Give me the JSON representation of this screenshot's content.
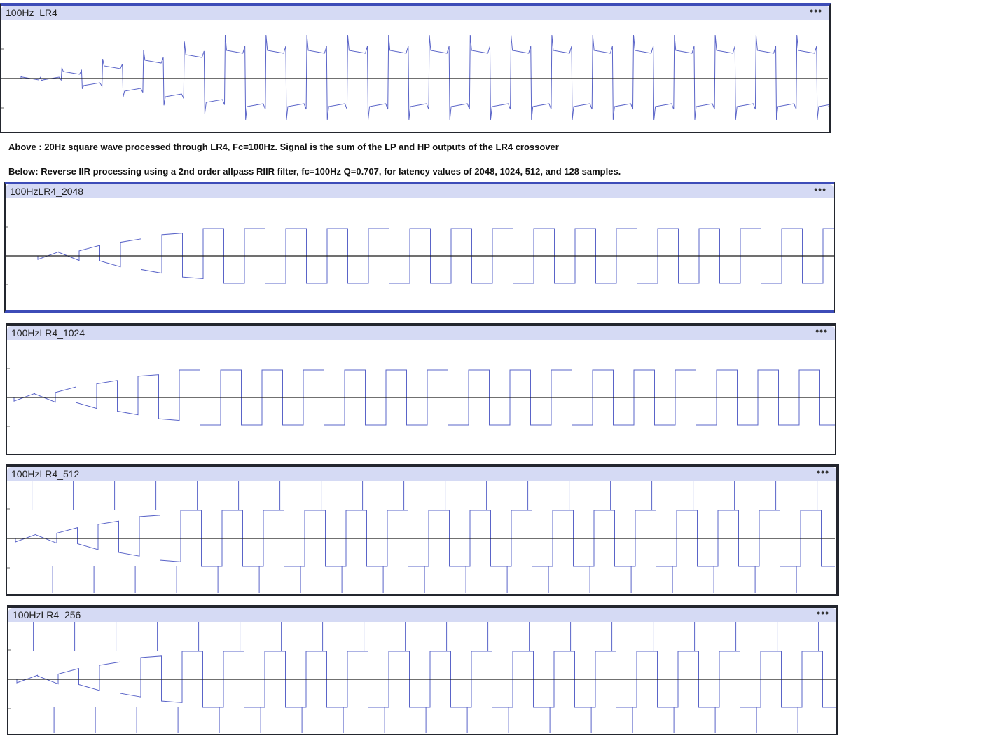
{
  "tracks": [
    {
      "name": "100Hz_LR4",
      "menu": "•••"
    },
    {
      "name": "100HzLR4_2048",
      "menu": "•••"
    },
    {
      "name": "100HzLR4_1024",
      "menu": "•••"
    },
    {
      "name": "100HzLR4_512",
      "menu": "•••"
    },
    {
      "name": "100HzLR4_256",
      "menu": "•••"
    }
  ],
  "captions": {
    "above": "Above : 20Hz square wave processed through LR4, Fc=100Hz. Signal is the sum of the LP and HP outputs of the LR4 crossover",
    "below": "Below: Reverse IIR processing using a 2nd order allpass RIIR filter, fc=100Hz Q=0.707, for latency values of 2048, 1024, 512, and 128 samples."
  },
  "colors": {
    "waveform": "#5a64c8",
    "centerline": "#1a1a1a",
    "titlebar": "#d5daf4",
    "accent": "#3d4cb8"
  },
  "waveform_kind": [
    "lr4",
    "riir2048",
    "riir1024",
    "riir512",
    "riir256"
  ]
}
